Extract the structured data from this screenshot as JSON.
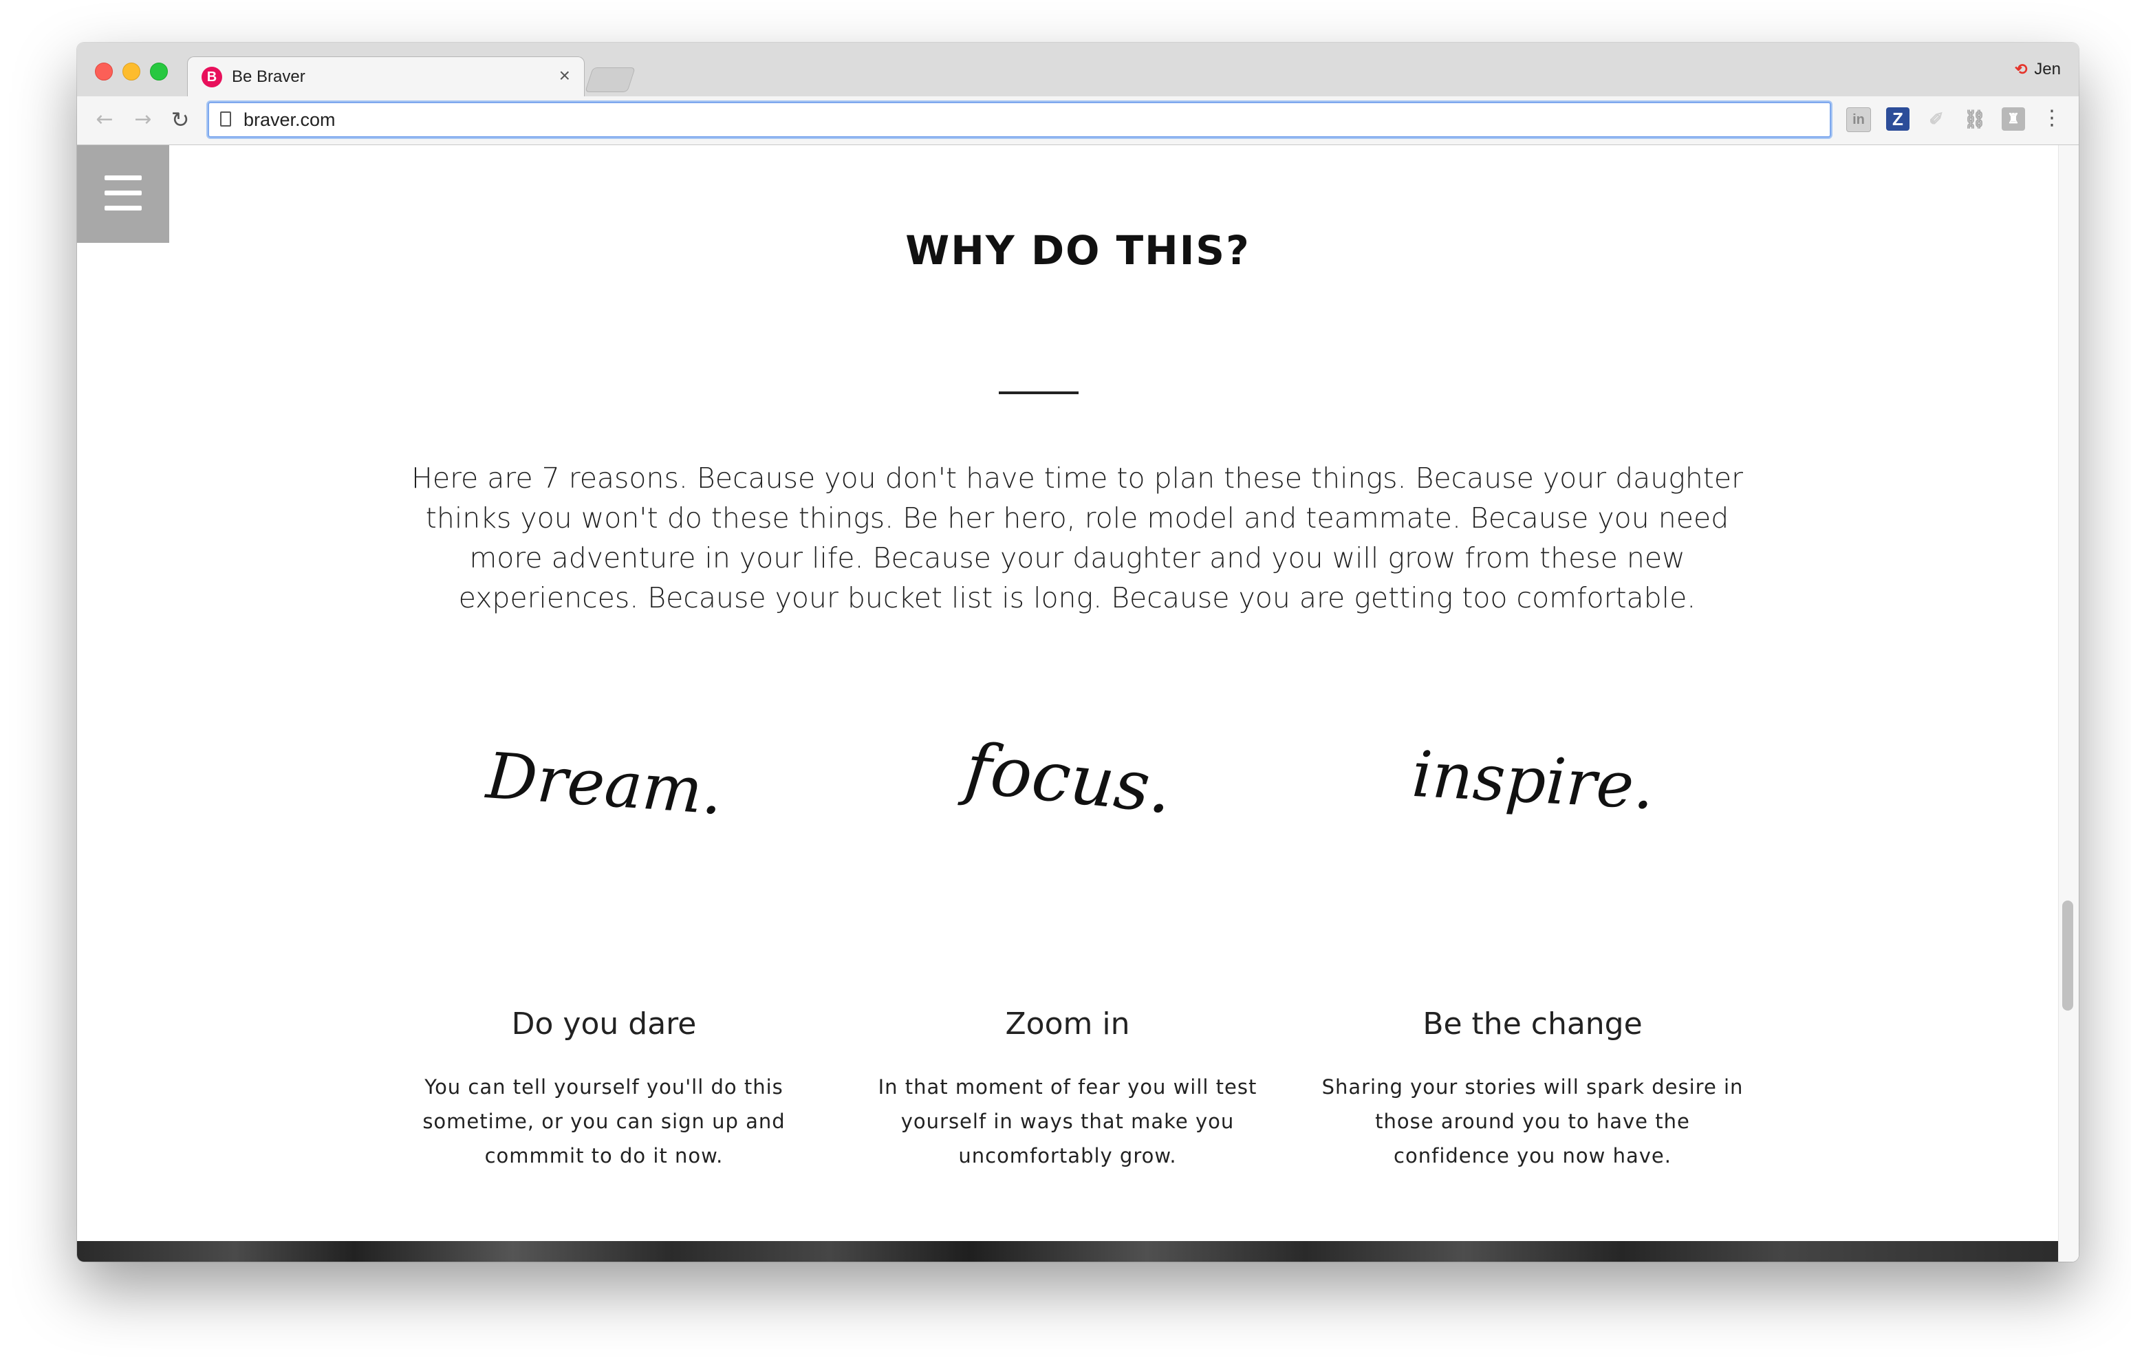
{
  "browser": {
    "tab_title": "Be Braver",
    "tab_favicon": "B",
    "tab_close": "×",
    "profile_name": "Jen",
    "url": "braver.com",
    "icons": [
      "back-arrow-icon",
      "forward-arrow-icon",
      "reload-icon",
      "page-icon",
      "linkedin-extension-icon",
      "z-extension-icon",
      "extension-icon",
      "extension-icon",
      "extension-icon",
      "menu-dots-icon"
    ]
  },
  "page": {
    "heading": "WHY DO THIS?",
    "intro": "Here are 7 reasons. Because you don't have time to plan these things. Because your daughter thinks you won't do these things. Be her hero, role model and teammate. Because you need more adventure in your life. Because your daughter and you will grow from these new experiences. Because your bucket list is long. Because you are getting too comfortable.",
    "columns": [
      {
        "script_word": "Dream.",
        "title": "Do you dare",
        "text": "You can tell yourself you'll do this sometime, or you can sign up and commmit to do it now."
      },
      {
        "script_word": "focus.",
        "title": "Zoom in",
        "text": "In that moment of fear you will test yourself in ways that make you uncomfortably grow."
      },
      {
        "script_word": "inspire.",
        "title": "Be the change",
        "text": "Sharing your stories will spark desire in those around you to have the confidence you now have."
      }
    ]
  },
  "colors": {
    "accent": "#e8105b",
    "text": "#222222",
    "menu_button": "#a8a8a8",
    "omnibox_focus": "#7ea8ee"
  }
}
